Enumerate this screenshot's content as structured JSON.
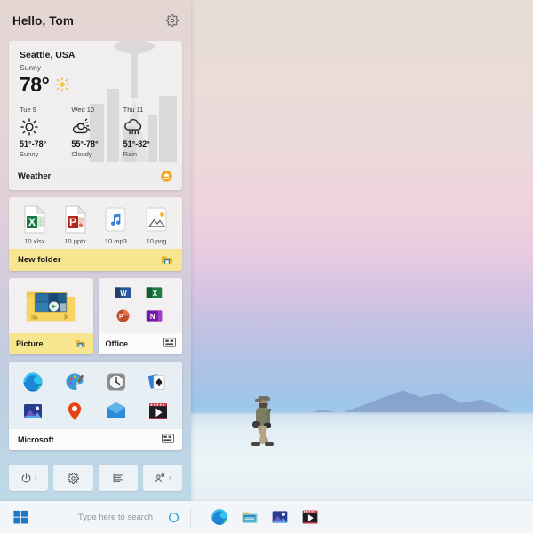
{
  "desktop": {
    "wallpaper_description": "Salt flat landscape at dusk with distant blue mountains and a person walking",
    "sky_top_color": "#e8dcd8",
    "sky_mid_color": "#e7cbe0",
    "sky_bottom_color": "#9ec6e8",
    "ground_color": "#edf4f8",
    "mountain_color": "#7f9cc9"
  },
  "start_menu": {
    "greeting": "Hello, Tom",
    "settings_icon": "gear-icon",
    "weather": {
      "city": "Seattle, USA",
      "condition": "Sunny",
      "temperature": "78°",
      "current_icon": "sun-icon",
      "tile_label": "Weather",
      "badge_icon": "partly-sunny-badge-icon",
      "forecast": [
        {
          "day": "Tue 9",
          "icon": "sun-icon",
          "range": "51°-78°",
          "condition": "Sunny"
        },
        {
          "day": "Wed 10",
          "icon": "partly-cloudy-icon",
          "range": "55°-78°",
          "condition": "Cloudy"
        },
        {
          "day": "Thu 11",
          "icon": "rain-icon",
          "range": "51°-82°",
          "condition": "Rain"
        }
      ]
    },
    "files_group": {
      "folder_label": "New folder",
      "folder_icon": "folder-badge-icon",
      "files": [
        {
          "name": "10.xlsx",
          "icon": "excel-file-icon"
        },
        {
          "name": "10.pptx",
          "icon": "powerpoint-file-icon"
        },
        {
          "name": "10.mp3",
          "icon": "music-file-icon"
        },
        {
          "name": "10.png",
          "icon": "image-file-icon"
        }
      ]
    },
    "picture_tile": {
      "label": "Picture",
      "bar_icon": "folder-badge-icon",
      "thumb_icon": "picture-folder-icon"
    },
    "office_tile": {
      "label": "Office",
      "bar_icon": "group-tile-icon",
      "apps": [
        {
          "name": "Word",
          "icon": "word-icon"
        },
        {
          "name": "Excel",
          "icon": "excel-icon"
        },
        {
          "name": "PowerPoint",
          "icon": "powerpoint-icon"
        },
        {
          "name": "OneNote",
          "icon": "onenote-icon"
        }
      ]
    },
    "microsoft_tile": {
      "label": "Microsoft",
      "bar_icon": "group-tile-icon",
      "apps": [
        {
          "name": "Microsoft Edge",
          "icon": "edge-icon"
        },
        {
          "name": "Paint",
          "icon": "paint-icon"
        },
        {
          "name": "Alarms & Clock",
          "icon": "clock-icon"
        },
        {
          "name": "Solitaire",
          "icon": "cards-icon"
        },
        {
          "name": "Photos",
          "icon": "photos-icon"
        },
        {
          "name": "Maps",
          "icon": "map-pin-icon"
        },
        {
          "name": "Mail",
          "icon": "mail-icon"
        },
        {
          "name": "Movies & TV",
          "icon": "movies-tv-icon"
        }
      ]
    },
    "actions": [
      {
        "name": "Power",
        "icon": "power-icon",
        "chevron": "›"
      },
      {
        "name": "Settings",
        "icon": "gear-icon",
        "chevron": ""
      },
      {
        "name": "Documents",
        "icon": "list-icon",
        "chevron": ""
      },
      {
        "name": "Accounts",
        "icon": "person-tag-icon",
        "chevron": "›"
      }
    ]
  },
  "taskbar": {
    "start_icon": "windows-logo-icon",
    "search_placeholder": "Type here to search",
    "cortana_icon": "cortana-icon",
    "apps": [
      {
        "name": "Microsoft Edge",
        "icon": "edge-icon"
      },
      {
        "name": "File Explorer",
        "icon": "file-explorer-icon"
      },
      {
        "name": "Photos",
        "icon": "photos-icon"
      },
      {
        "name": "Movies & TV",
        "icon": "movies-tv-icon"
      }
    ]
  }
}
